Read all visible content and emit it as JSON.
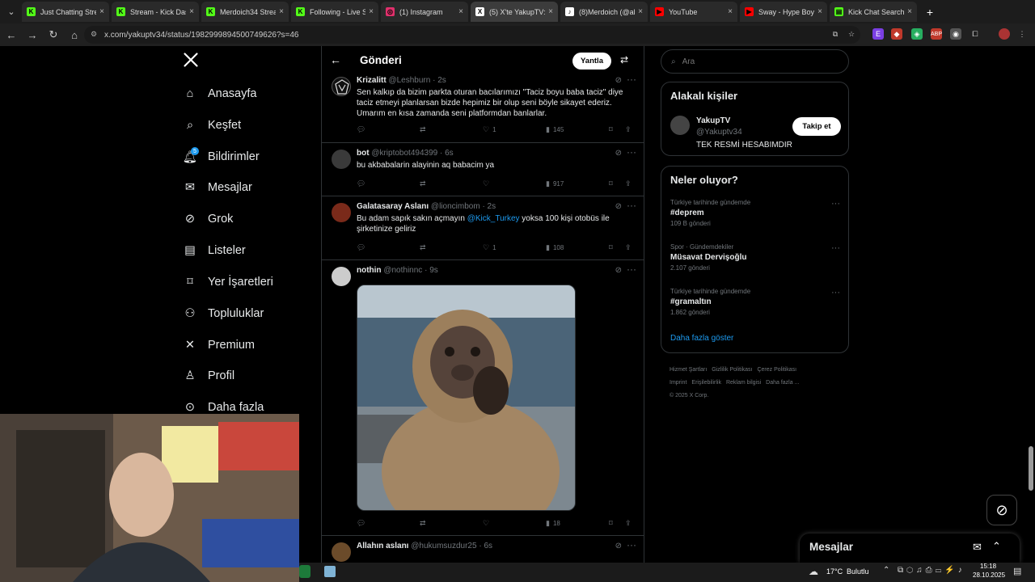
{
  "browser": {
    "tabs": [
      {
        "title": "Just Chatting Stre",
        "icon": "K",
        "color": "#53fc18"
      },
      {
        "title": "Stream - Kick Das",
        "icon": "K",
        "color": "#53fc18"
      },
      {
        "title": "Merdoich34 Strea",
        "icon": "K",
        "color": "#53fc18"
      },
      {
        "title": "Following - Live S",
        "icon": "K",
        "color": "#53fc18"
      },
      {
        "title": "(1) Instagram",
        "icon": "◎",
        "color": "#e1306c"
      },
      {
        "title": "(5) X'te YakupTV:",
        "icon": "X",
        "color": "#ffffff"
      },
      {
        "title": "(8)Merdoich (@al",
        "icon": "♪",
        "color": "#ffffff"
      },
      {
        "title": "YouTube",
        "icon": "▶",
        "color": "#ff0000"
      },
      {
        "title": "Sway - Hype Boys",
        "icon": "▶",
        "color": "#ff0000"
      },
      {
        "title": "Kick Chat Search",
        "icon": "▤",
        "color": "#53fc18"
      }
    ],
    "url": "x.com/yakuptv34/status/1982999894500749626?s=46"
  },
  "nav": {
    "items": [
      {
        "label": "Anasayfa",
        "icon": "home-icon"
      },
      {
        "label": "Keşfet",
        "icon": "search-icon"
      },
      {
        "label": "Bildirimler",
        "icon": "bell-icon"
      },
      {
        "label": "Mesajlar",
        "icon": "mail-icon"
      },
      {
        "label": "Grok",
        "icon": "grok-icon"
      },
      {
        "label": "Listeler",
        "icon": "list-icon"
      },
      {
        "label": "Yer İşaretleri",
        "icon": "bookmark-icon"
      },
      {
        "label": "Topluluklar",
        "icon": "communities-icon"
      },
      {
        "label": "Premium",
        "icon": "x-icon"
      },
      {
        "label": "Profil",
        "icon": "person-icon"
      },
      {
        "label": "Daha fazla",
        "icon": "more-icon"
      }
    ],
    "notif_badge": "5"
  },
  "main": {
    "title": "Gönderi",
    "reply_label": "Yantla",
    "tweets": [
      {
        "name": "Krizalitt",
        "handle": "@Leshburn",
        "time": "2s",
        "text": "Sen kalkıp da bizim parkta oturan bacılarımızı \"Taciz boyu baba taciz\" diye taciz etmeyi planlarsan bizde hepimiz bir olup seni böyle sikayet ederiz. Umarım en kısa zamanda seni platformdan banlarlar.",
        "likes": "1",
        "views": "145"
      },
      {
        "name": "bot",
        "handle": "@kriptobot494399",
        "time": "6s",
        "text": "bu akbabalarin alayinin aq babacim ya",
        "likes": "",
        "views": "917"
      },
      {
        "name": "Galatasaray Aslanı",
        "handle": "@lioncimbom",
        "time": "2s",
        "text_before": "Bu adam sapık sakın açmayın ",
        "mention": "@Kick_Turkey",
        "text_after": " yoksa 100 kişi otobüs ile şirketinize geliriz",
        "likes": "1",
        "views": "108"
      },
      {
        "name": "nothin",
        "handle": "@nothinnc",
        "time": "9s",
        "text": "",
        "likes": "",
        "views": "18"
      },
      {
        "name": "Allahın aslanı",
        "handle": "@hukumsuzdur25",
        "time": "6s"
      }
    ]
  },
  "right": {
    "search_placeholder": "Ara",
    "related_title": "Alakalı kişiler",
    "person": {
      "name": "YakupTV",
      "handle": "@Yakuptv34",
      "bio": "TEK RESMİ HESABIMDIR",
      "follow_label": "Takip et"
    },
    "trends_title": "Neler oluyor?",
    "trends": [
      {
        "context": "Türkiye tarihinde gündemde",
        "tag": "#deprem",
        "count": "109 B gönderi"
      },
      {
        "context": "Spor · Gündemdekiler",
        "tag": "Müsavat Dervişoğlu",
        "count": "2.107 gönderi"
      },
      {
        "context": "Türkiye tarihinde gündemde",
        "tag": "#gramaltın",
        "count": "1.862 gönderi"
      }
    ],
    "show_more": "Daha fazla göster",
    "footer": [
      "Hizmet Şartları",
      "Gizlilik Politikası",
      "Çerez Politikası",
      "Imprint",
      "Erişilebilirlik",
      "Reklam bilgisi",
      "Daha fazla ...",
      "© 2025 X Corp."
    ]
  },
  "messages": {
    "title": "Mesajlar"
  },
  "taskbar": {
    "weather": "17°C",
    "weather_desc": "Bulutlu",
    "time": "15:18",
    "date": "28.10.2025"
  },
  "colors": {
    "accent": "#1d9bf0",
    "bg": "#000000",
    "border": "#2f3336",
    "muted": "#71767b"
  }
}
